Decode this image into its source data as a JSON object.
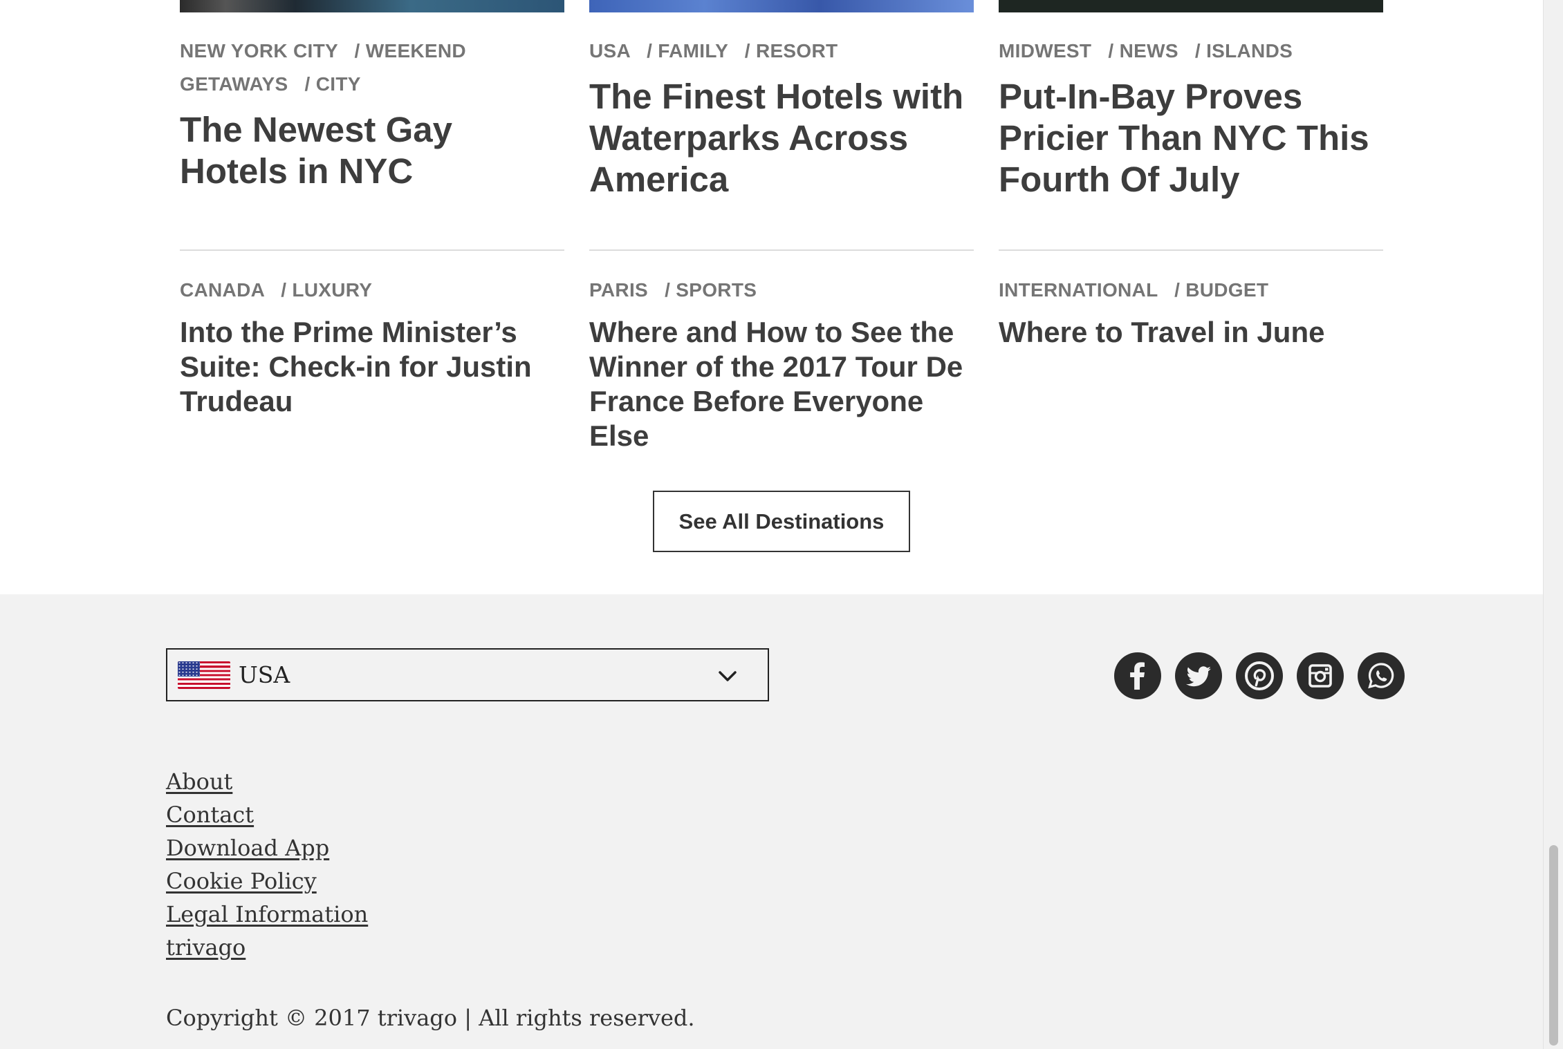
{
  "articles": [
    {
      "tags": [
        "NEW YORK CITY",
        "WEEKEND GETAWAYS",
        "CITY"
      ],
      "title": "The Newest Gay Hotels in NYC"
    },
    {
      "tags": [
        "USA",
        "FAMILY",
        "RESORT"
      ],
      "title": "The Finest Hotels with Waterparks Across America"
    },
    {
      "tags": [
        "MIDWEST",
        "NEWS",
        "ISLANDS"
      ],
      "title": "Put-In-Bay Proves Pricier Than NYC This Fourth Of July"
    },
    {
      "tags": [
        "CANADA",
        "LUXURY"
      ],
      "title": "Into the Prime Minister’s Suite: Check-in for Justin Trudeau"
    },
    {
      "tags": [
        "PARIS",
        "SPORTS"
      ],
      "title": "Where and How to See the Winner of the 2017 Tour De France Before Everyone Else"
    },
    {
      "tags": [
        "INTERNATIONAL",
        "BUDGET"
      ],
      "title": "Where to Travel in June"
    }
  ],
  "tag_separator": "/",
  "see_all_label": "See All Destinations",
  "footer": {
    "country": {
      "selected": "USA",
      "flag_icon": "us-flag-icon",
      "chevron_icon": "chevron-down-icon"
    },
    "social_icons": [
      "facebook-icon",
      "twitter-icon",
      "pinterest-icon",
      "instagram-icon",
      "whatsapp-icon"
    ],
    "links": [
      "About",
      "Contact",
      "Download App",
      "Cookie Policy",
      "Legal Information",
      "trivago"
    ],
    "copyright": "Copyright © 2017 trivago | All rights reserved."
  },
  "colors": {
    "footer_bg": "#f2f2f2",
    "text_dark": "#3d3d3d",
    "tag_gray": "#757575",
    "icon_dark": "#2b2b2b"
  }
}
